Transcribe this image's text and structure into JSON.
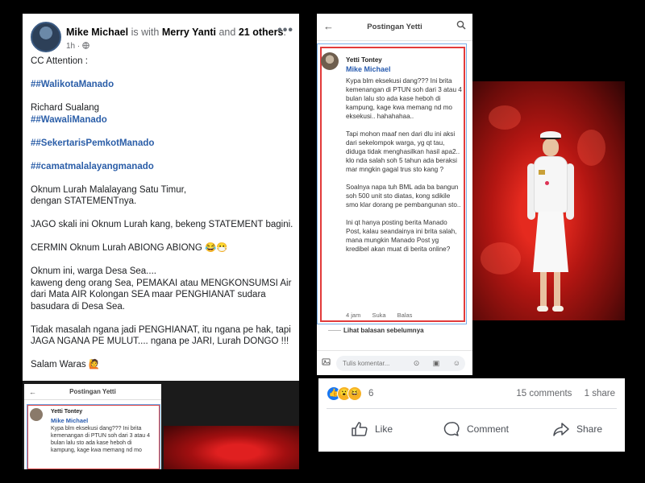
{
  "left_post": {
    "author": "Mike Michael",
    "with_text": "is with",
    "tagged": "Merry Yanti",
    "and_text": "and",
    "others": "21 others",
    "period": ".",
    "time": "1h",
    "time_sep": "·",
    "more": "•••",
    "body": [
      {
        "text": "CC Attention :",
        "type": "text"
      },
      {
        "text": "",
        "type": "gap"
      },
      {
        "text": "##WalikotaManado",
        "type": "tag"
      },
      {
        "text": "",
        "type": "gap"
      },
      {
        "text": "Richard Sualang",
        "type": "text"
      },
      {
        "text": "##WawaliManado",
        "type": "tag"
      },
      {
        "text": "",
        "type": "gap"
      },
      {
        "text": "##SekertarisPemkotManado",
        "type": "tag"
      },
      {
        "text": "",
        "type": "gap"
      },
      {
        "text": "##camatmalalayangmanado",
        "type": "tag"
      },
      {
        "text": "",
        "type": "gap"
      },
      {
        "text": "Oknum Lurah Malalayang Satu Timur,",
        "type": "text"
      },
      {
        "text": "dengan STATEMENTnya.",
        "type": "text"
      },
      {
        "text": "",
        "type": "gap"
      },
      {
        "text": "JAGO skali ini Oknum Lurah kang, bekeng STATEMENT bagini.",
        "type": "text"
      },
      {
        "text": "",
        "type": "gap"
      },
      {
        "text": "CERMIN Oknum Lurah ABIONG ABIONG 😂😷",
        "type": "text"
      },
      {
        "text": "",
        "type": "gap"
      },
      {
        "text": "Oknum ini, warga Desa Sea....",
        "type": "text"
      },
      {
        "text": "kaweng deng orang Sea, PEMAKAI atau MENGKONSUMSI Air",
        "type": "text"
      },
      {
        "text": "dari Mata AIR Kolongan SEA maar PENGHIANAT sudara",
        "type": "text"
      },
      {
        "text": "basudara di Desa Sea.",
        "type": "text"
      },
      {
        "text": "",
        "type": "gap"
      },
      {
        "text": "Tidak masalah ngana jadi PENGHIANAT, itu ngana pe hak, tapi",
        "type": "text"
      },
      {
        "text": "JAGA NGANA PE MULUT.... ngana pe JARI, Lurah DONGO !!!",
        "type": "text"
      },
      {
        "text": "",
        "type": "gap"
      },
      {
        "text": "Salam Waras 🙋",
        "type": "text"
      }
    ],
    "embed_thumb": {
      "title": "Postingan Yetti",
      "name": "Yetti Tontey",
      "mention": "Mike Michael",
      "text": "Kypa blm eksekusi dang??? Ini brita kemenangan di PTUN soh dari 3 atau 4 bulan lalu sto ada kase heboh di kampung, kage kwa memang nd mo"
    }
  },
  "phone": {
    "back": "←",
    "title": "Postingan Yetti",
    "search": "⚲",
    "comment": {
      "name": "Yetti Tontey",
      "mention": "Mike Michael",
      "paragraphs": [
        "Kypa blm eksekusi dang??? Ini brita kemenangan  di PTUN soh dari 3 atau 4 bulan lalu sto ada kase heboh di kampung, kage kwa memang nd mo eksekusi.. hahahahaa..",
        "Tapi mohon maaf nen dari dlu ini aksi dari sekelompok warga, yg qt tau, diduga tidak menghasilkan hasil apa2.. klo nda salah soh 5 tahun ada beraksi mar mngkin gagal trus sto kang ?",
        "Soalnya napa tuh BML ada ba bangun soh 500 unit sto diatas, kong sdikile smo klar dorang pe pembangunan sto..",
        "Ini qt hanya posting berita Manado Post, kalau seandainya ini brita salah, mana mungkin Manado Post yg kredibel akan muat di berita online?"
      ],
      "time": "4 jam",
      "like": "Suka",
      "reply": "Balas"
    },
    "more_replies": "Lihat balasan sebelumnya",
    "comment_placeholder": "Tulis komentar...",
    "input_icons": "⊙ ▣ ☺"
  },
  "footer": {
    "reactions": {
      "like": "👍",
      "wow": "😮",
      "haha": "😆"
    },
    "reaction_count": "6",
    "comments": "15 comments",
    "shares": "1 share",
    "like_label": "Like",
    "comment_label": "Comment",
    "share_label": "Share"
  }
}
